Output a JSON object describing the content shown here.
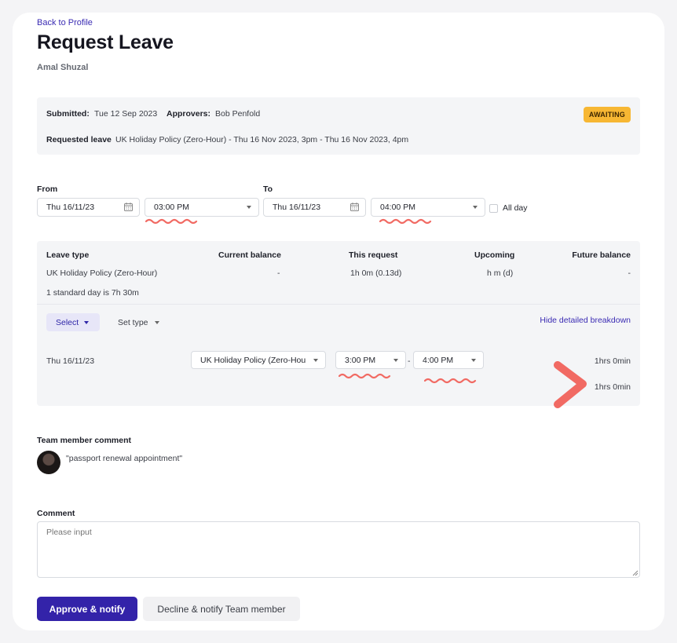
{
  "header": {
    "back_link": "Back to Profile",
    "title": "Request Leave",
    "employee_name": "Amal Shuzal"
  },
  "summary": {
    "submitted_label": "Submitted:",
    "submitted_value": "Tue 12 Sep 2023",
    "approvers_label": "Approvers:",
    "approvers_value": "Bob Penfold",
    "status_badge": "AWAITING",
    "requested_label": "Requested leave",
    "requested_value": "UK Holiday Policy (Zero-Hour) - Thu 16 Nov 2023, 3pm - Thu 16 Nov 2023, 4pm"
  },
  "dates": {
    "from_label": "From",
    "from_date": "Thu 16/11/23",
    "from_time": "03:00 PM",
    "to_label": "To",
    "to_date": "Thu 16/11/23",
    "to_time": "04:00 PM",
    "all_day_label": "All day",
    "all_day_checked": false
  },
  "breakdown": {
    "headers": {
      "leave_type": "Leave type",
      "current_balance": "Current balance",
      "this_request": "This request",
      "upcoming": "Upcoming",
      "future_balance": "Future balance"
    },
    "row": {
      "leave_type": "UK Holiday Policy (Zero-Hour)",
      "current_balance": "-",
      "this_request": "1h 0m (0.13d)",
      "upcoming": "h m (d)",
      "future_balance": "-"
    },
    "standard_day_note": "1 standard day is 7h 30m",
    "select_label": "Select",
    "set_type_label": "Set type",
    "hide_link": "Hide detailed breakdown",
    "detail": {
      "date": "Thu 16/11/23",
      "policy": "UK Holiday Policy (Zero-Hou",
      "start_time": "3:00 PM",
      "separator": "-",
      "end_time": "4:00 PM",
      "duration": "1hrs 0min",
      "total": "1hrs 0min"
    }
  },
  "team_comment": {
    "label": "Team member comment",
    "text": "\"passport renewal appointment\""
  },
  "comment": {
    "label": "Comment",
    "placeholder": "Please input"
  },
  "actions": {
    "approve": "Approve & notify",
    "decline": "Decline & notify Team member"
  },
  "colors": {
    "primary": "#3323a9",
    "badge": "#f7b733",
    "annotation": "#f16a63"
  }
}
